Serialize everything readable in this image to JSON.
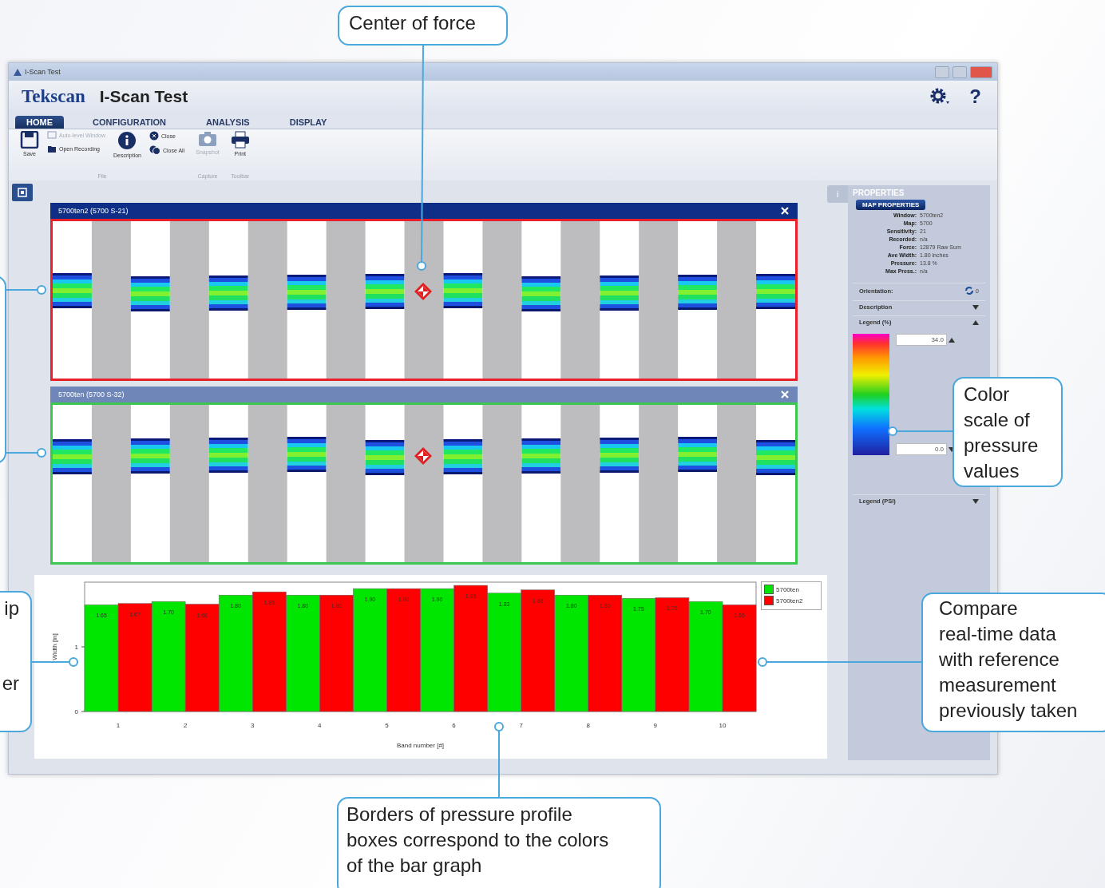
{
  "window": {
    "title": "I-Scan Test",
    "brand": "Tekscan",
    "app_title": "I-Scan Test",
    "help": "?"
  },
  "tabs": [
    {
      "label": "HOME",
      "selected": true
    },
    {
      "label": "CONFIGURATION",
      "selected": false
    },
    {
      "label": "ANALYSIS",
      "selected": false
    },
    {
      "label": "DISPLAY",
      "selected": false
    }
  ],
  "ribbon": {
    "groups": [
      {
        "label": "File",
        "items": [
          {
            "kind": "large",
            "label": "Save",
            "disabled": false
          },
          {
            "kind": "small",
            "label": "Auto-level Window",
            "disabled": true
          },
          {
            "kind": "small",
            "label": "Open Recording",
            "disabled": false
          },
          {
            "kind": "large",
            "label": "Description",
            "disabled": false
          },
          {
            "kind": "small",
            "label": "Close",
            "disabled": false
          },
          {
            "kind": "small",
            "label": "Close All",
            "disabled": false
          }
        ]
      },
      {
        "label": "Capture",
        "items": [
          {
            "kind": "large",
            "label": "Snapshot",
            "disabled": true
          }
        ]
      },
      {
        "label": "Toolbar",
        "items": [
          {
            "kind": "large",
            "label": "Print",
            "disabled": false
          }
        ]
      }
    ]
  },
  "sensor_panels": [
    {
      "title": "5700ten2 (5700 S-21)",
      "active": true,
      "color": "#e8202a"
    },
    {
      "title": "5700ten (5700 S-32)",
      "active": false,
      "color": "#3cc850"
    }
  ],
  "chart": {
    "chart_data": {
      "type": "bar",
      "xlabel": "Band number [#]",
      "ylabel": "Width [in]",
      "categories": [
        "1",
        "2",
        "3",
        "4",
        "5",
        "6",
        "7",
        "8",
        "9",
        "10"
      ],
      "ylim": [
        0,
        2
      ],
      "yticks": [
        0,
        1
      ],
      "series": [
        {
          "name": "5700ten",
          "color": "#00e600",
          "values": [
            1.65,
            1.7,
            1.8,
            1.8,
            1.9,
            1.9,
            1.83,
            1.8,
            1.75,
            1.7
          ],
          "value_labels": [
            "1.65",
            "1.70",
            "1.80",
            "1.80",
            "1.90",
            "1.90",
            "1.83",
            "1.80",
            "1.75",
            "1.70"
          ]
        },
        {
          "name": "5700ten2",
          "color": "#ff0000",
          "values": [
            1.67,
            1.66,
            1.85,
            1.8,
            1.9,
            1.95,
            1.88,
            1.8,
            1.76,
            1.65
          ],
          "value_labels": [
            "1.67",
            "1.66",
            "1.85",
            "1.80",
            "1.90",
            "1.95",
            "1.88",
            "1.80",
            "1.76",
            "1.65"
          ]
        }
      ]
    }
  },
  "properties": {
    "tab": "i",
    "title": "PROPERTIES",
    "section": "MAP PROPERTIES",
    "fields": [
      {
        "label": "Window:",
        "value": "5700ten2"
      },
      {
        "label": "Map:",
        "value": "5700"
      },
      {
        "label": "Sensitivity:",
        "value": "21"
      },
      {
        "label": "Recorded:",
        "value": "n/a"
      },
      {
        "label": "Force:",
        "value": "12879 Raw Sum"
      },
      {
        "label": "Ave Width:",
        "value": "1.80 inches"
      },
      {
        "label": "Pressure:",
        "value": "13.8 %"
      },
      {
        "label": "Max Press.:",
        "value": "n/a"
      }
    ],
    "orientation": {
      "label": "Orientation:",
      "value": "0"
    },
    "sections": [
      {
        "label": "Description",
        "expanded": false
      },
      {
        "label": "Legend (%)",
        "expanded": true,
        "max": "34.0",
        "min": "0.0"
      },
      {
        "label": "Legend (PSI)",
        "expanded": false
      }
    ]
  },
  "callouts": [
    {
      "lines": [
        "Center of force"
      ]
    },
    {
      "lines": [
        "Color",
        "scale of",
        "pressure",
        "values"
      ]
    },
    {
      "lines": [
        "Compare",
        "real-time data",
        "with reference",
        "measurement",
        "previously taken"
      ]
    },
    {
      "lines": [
        "Borders of pressure profile",
        "boxes correspond to the colors",
        "of the bar graph"
      ]
    }
  ],
  "cut_callout": [
    "ip",
    "er"
  ]
}
